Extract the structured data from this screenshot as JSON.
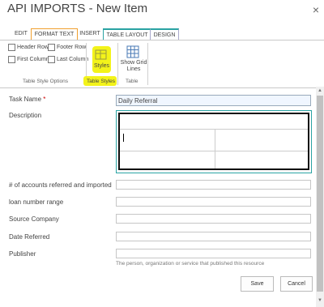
{
  "window": {
    "title": "API IMPORTS - New Item",
    "close_glyph": "×"
  },
  "tabs": [
    {
      "label": "EDIT"
    },
    {
      "label": "FORMAT TEXT"
    },
    {
      "label": "INSERT"
    },
    {
      "label": "TABLE LAYOUT"
    },
    {
      "label": "DESIGN"
    }
  ],
  "ribbon": {
    "table_style_options": {
      "header_row": "Header Row",
      "footer_row": "Footer Row",
      "first_column": "First Column",
      "last_column": "Last Column",
      "group_label": "Table Style Options"
    },
    "table_styles": {
      "styles_label": "Styles",
      "group_label": "Table Styles"
    },
    "table": {
      "show_grid_lines_label": "Show Grid Lines",
      "group_label": "Table"
    },
    "highlight_color": "#f3f31a"
  },
  "form": {
    "task_name": {
      "label": "Task Name",
      "required_mark": "*",
      "value": "Daily Referral"
    },
    "description": {
      "label": "Description"
    },
    "accounts": {
      "label": "# of accounts referred and imported",
      "value": ""
    },
    "loan_range": {
      "label": "loan number range",
      "value": ""
    },
    "source_company": {
      "label": "Source Company",
      "value": ""
    },
    "date_referred": {
      "label": "Date Referred",
      "value": ""
    },
    "publisher": {
      "label": "Publisher",
      "value": "",
      "hint": "The person, organization or service that published this resource"
    }
  },
  "buttons": {
    "save": "Save",
    "cancel": "Cancel"
  }
}
